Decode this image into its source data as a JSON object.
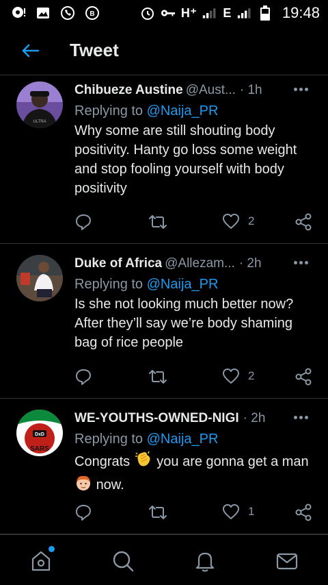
{
  "status_bar": {
    "network_label": "H⁺",
    "network_label_2": "E",
    "time": "19:48"
  },
  "header": {
    "title": "Tweet",
    "back_icon": "arrow-left-icon"
  },
  "tweets": [
    {
      "name": "Chibueze Austine",
      "handle": "@Aust...",
      "time": "· 1h",
      "reply_prefix": "Replying to",
      "reply_to": "@Naija_PR",
      "body": "Why some are still shouting body positivity. Hanty go loss some weight and stop fooling yourself with body positivity",
      "like_count": "2"
    },
    {
      "name": "Duke of Africa",
      "handle": "@Allezam...",
      "time": "· 2h",
      "reply_prefix": "Replying to",
      "reply_to": "@Naija_PR",
      "body": "Is she not looking much better now? After they’ll say we’re body shaming bag of rice people",
      "like_count": "2"
    },
    {
      "name": "WE-YOUTHS-OWNED-NIGI",
      "handle": "",
      "time": "· 2h",
      "reply_prefix": "Replying to",
      "reply_to": "@Naija_PR",
      "body_part1": "Congrats",
      "body_part2": "you are gonna get a man",
      "body_part3": "now.",
      "like_count": "1",
      "avatar_text": "SARS"
    }
  ],
  "colors": {
    "background": "#000000",
    "accent": "#1d9bf0",
    "muted": "#8b98a5",
    "divider": "#2f3336"
  },
  "bottom_nav": [
    "home-icon",
    "search-icon",
    "notifications-icon",
    "messages-icon"
  ]
}
